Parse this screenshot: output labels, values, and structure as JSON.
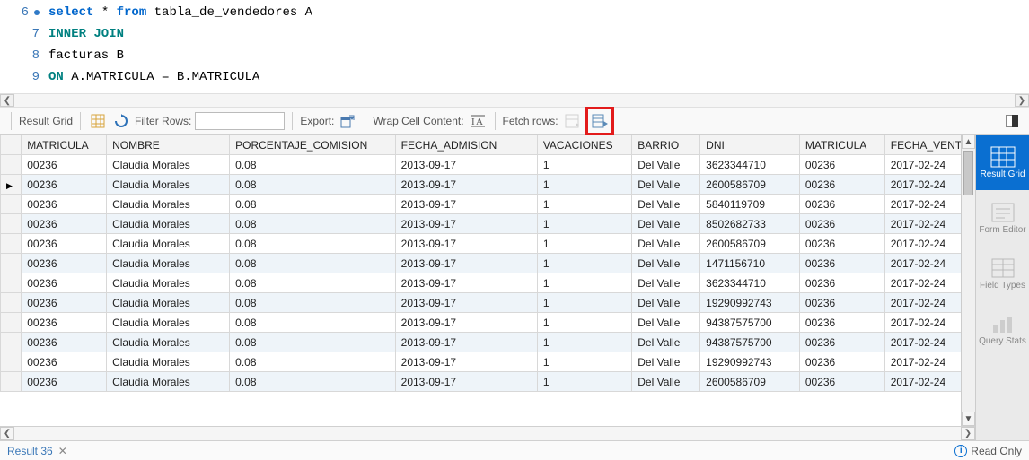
{
  "editor": {
    "lines": [
      {
        "num": 6,
        "marker": true,
        "tokens": [
          {
            "cls": "kw-blue",
            "t": "select "
          },
          {
            "cls": "plain",
            "t": "* "
          },
          {
            "cls": "kw-blue",
            "t": "from "
          },
          {
            "cls": "plain",
            "t": "tabla_de_vendedores A"
          }
        ]
      },
      {
        "num": 7,
        "marker": false,
        "tokens": [
          {
            "cls": "kw-teal",
            "t": "INNER JOIN"
          }
        ]
      },
      {
        "num": 8,
        "marker": false,
        "tokens": [
          {
            "cls": "plain",
            "t": "facturas B"
          }
        ]
      },
      {
        "num": 9,
        "marker": false,
        "tokens": [
          {
            "cls": "kw-teal",
            "t": "ON "
          },
          {
            "cls": "plain",
            "t": "A.MATRICULA = B.MATRICULA"
          }
        ]
      }
    ]
  },
  "toolbar": {
    "result_grid_label": "Result Grid",
    "filter_rows_label": "Filter Rows:",
    "filter_value": "",
    "export_label": "Export:",
    "wrap_label": "Wrap Cell Content:",
    "fetch_label": "Fetch rows:"
  },
  "columns": [
    "MATRICULA",
    "NOMBRE",
    "PORCENTAJE_COMISION",
    "FECHA_ADMISION",
    "VACACIONES",
    "BARRIO",
    "DNI",
    "MATRICULA",
    "FECHA_VENTA"
  ],
  "rows": [
    {
      "sel": false,
      "c": [
        "00236",
        "Claudia Morales",
        "0.08",
        "2013-09-17",
        "1",
        "Del Valle",
        "3623344710",
        "00236",
        "2017-02-24"
      ]
    },
    {
      "sel": true,
      "c": [
        "00236",
        "Claudia Morales",
        "0.08",
        "2013-09-17",
        "1",
        "Del Valle",
        "2600586709",
        "00236",
        "2017-02-24"
      ]
    },
    {
      "sel": false,
      "c": [
        "00236",
        "Claudia Morales",
        "0.08",
        "2013-09-17",
        "1",
        "Del Valle",
        "5840119709",
        "00236",
        "2017-02-24"
      ]
    },
    {
      "sel": false,
      "c": [
        "00236",
        "Claudia Morales",
        "0.08",
        "2013-09-17",
        "1",
        "Del Valle",
        "8502682733",
        "00236",
        "2017-02-24"
      ]
    },
    {
      "sel": false,
      "c": [
        "00236",
        "Claudia Morales",
        "0.08",
        "2013-09-17",
        "1",
        "Del Valle",
        "2600586709",
        "00236",
        "2017-02-24"
      ]
    },
    {
      "sel": false,
      "c": [
        "00236",
        "Claudia Morales",
        "0.08",
        "2013-09-17",
        "1",
        "Del Valle",
        "1471156710",
        "00236",
        "2017-02-24"
      ]
    },
    {
      "sel": false,
      "c": [
        "00236",
        "Claudia Morales",
        "0.08",
        "2013-09-17",
        "1",
        "Del Valle",
        "3623344710",
        "00236",
        "2017-02-24"
      ]
    },
    {
      "sel": false,
      "c": [
        "00236",
        "Claudia Morales",
        "0.08",
        "2013-09-17",
        "1",
        "Del Valle",
        "19290992743",
        "00236",
        "2017-02-24"
      ]
    },
    {
      "sel": false,
      "c": [
        "00236",
        "Claudia Morales",
        "0.08",
        "2013-09-17",
        "1",
        "Del Valle",
        "94387575700",
        "00236",
        "2017-02-24"
      ]
    },
    {
      "sel": false,
      "c": [
        "00236",
        "Claudia Morales",
        "0.08",
        "2013-09-17",
        "1",
        "Del Valle",
        "94387575700",
        "00236",
        "2017-02-24"
      ]
    },
    {
      "sel": false,
      "c": [
        "00236",
        "Claudia Morales",
        "0.08",
        "2013-09-17",
        "1",
        "Del Valle",
        "19290992743",
        "00236",
        "2017-02-24"
      ]
    },
    {
      "sel": false,
      "c": [
        "00236",
        "Claudia Morales",
        "0.08",
        "2013-09-17",
        "1",
        "Del Valle",
        "2600586709",
        "00236",
        "2017-02-24"
      ]
    }
  ],
  "side": {
    "result_grid": "Result\nGrid",
    "form_editor": "Form\nEditor",
    "field_types": "Field\nTypes",
    "query_stats": "Query\nStats"
  },
  "footer": {
    "tab": "Result 36",
    "status": "Read Only"
  }
}
